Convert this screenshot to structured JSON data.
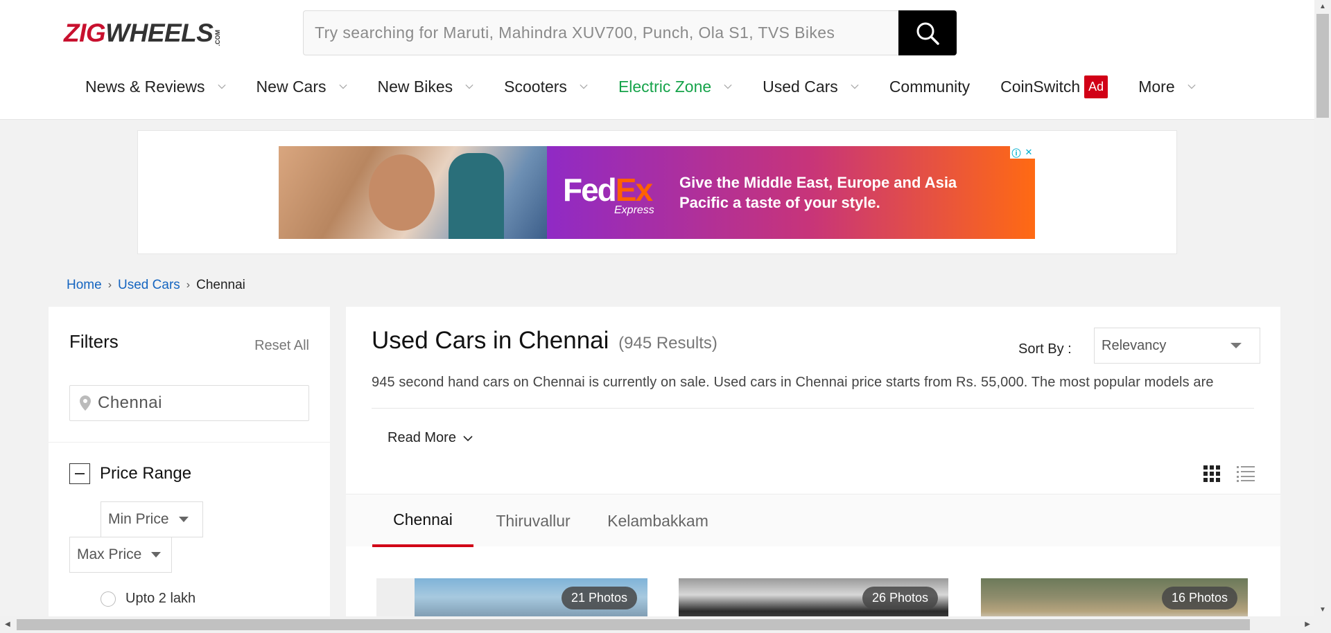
{
  "header": {
    "logo_main": "ZIG",
    "logo_wheels": "WHEELS",
    "logo_com": ".COM",
    "search_placeholder": "Try searching for Maruti, Mahindra XUV700, Punch, Ola S1, TVS Bikes",
    "nav": [
      {
        "label": "News & Reviews",
        "chevron": true,
        "color": "#222222"
      },
      {
        "label": "New Cars",
        "chevron": true,
        "color": "#222222"
      },
      {
        "label": "New Bikes",
        "chevron": true,
        "color": "#222222"
      },
      {
        "label": "Scooters",
        "chevron": true,
        "color": "#222222"
      },
      {
        "label": "Electric Zone",
        "chevron": true,
        "color": "#16a34a"
      },
      {
        "label": "Used Cars",
        "chevron": true,
        "color": "#222222"
      },
      {
        "label": "Community",
        "chevron": false,
        "color": "#222222"
      },
      {
        "label": "CoinSwitch",
        "chevron": false,
        "color": "#222222",
        "badge": "Ad"
      },
      {
        "label": "More",
        "chevron": true,
        "color": "#222222"
      }
    ]
  },
  "ad": {
    "brand_fed": "Fed",
    "brand_ex": "Ex",
    "brand_sub": "Express",
    "copy": "Give the Middle East, Europe and Asia Pacific a taste of your style.",
    "info_icon": "info-icon",
    "close_icon": "close-icon"
  },
  "breadcrumb": {
    "home": "Home",
    "used_cars": "Used Cars",
    "current": "Chennai",
    "separator": "›"
  },
  "filters": {
    "title": "Filters",
    "reset": "Reset All",
    "location_value": "Chennai",
    "price_range_label": "Price Range",
    "min_price": "Min Price",
    "max_price": "Max Price",
    "option_1": "Upto 2 lakh"
  },
  "main": {
    "title": "Used Cars in Chennai",
    "results": "(945 Results)",
    "sort_label": "Sort By :",
    "sort_value": "Relevancy",
    "description": "945 second hand cars on Chennai is currently on sale. Used cars in Chennai price starts from Rs. 55,000. The most popular models are",
    "read_more": "Read More",
    "tabs": [
      "Chennai",
      "Thiruvallur",
      "Kelambakkam"
    ],
    "active_tab": "Chennai",
    "cards": [
      {
        "photos": "21 Photos"
      },
      {
        "photos": "26 Photos"
      },
      {
        "photos": "16 Photos"
      }
    ]
  },
  "colors": {
    "brand_red": "#d10016",
    "link_blue": "#1565c0",
    "electric_green": "#16a34a"
  }
}
